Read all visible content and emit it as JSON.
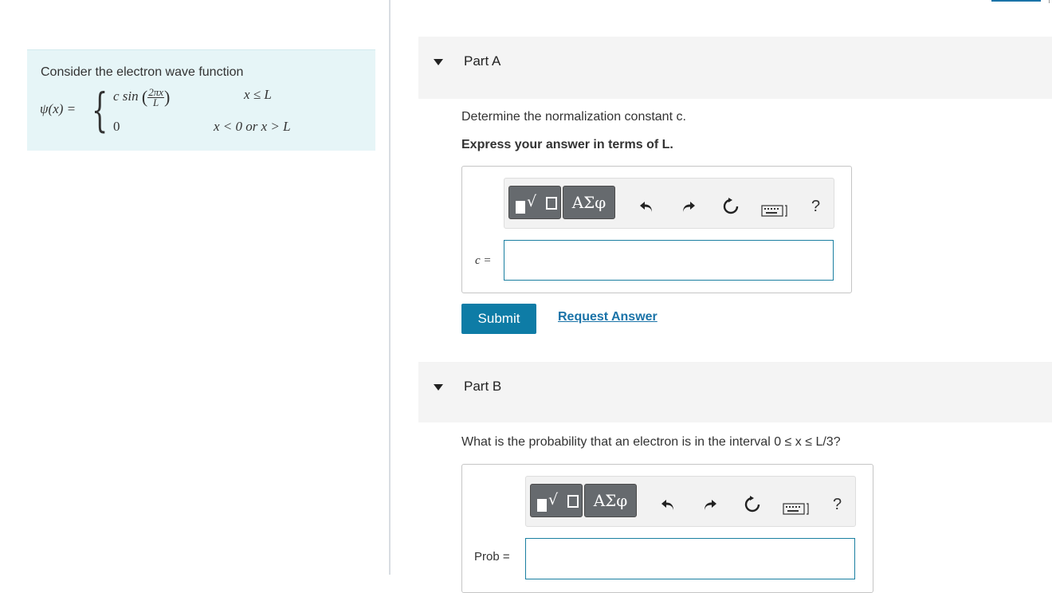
{
  "problem": {
    "intro": "Consider the electron wave function",
    "lhs": "ψ(x) =",
    "case1": {
      "prefix": "c sin",
      "frac_num": "2πx",
      "frac_den": "L",
      "condition": "x ≤ L"
    },
    "case2": {
      "value": "0",
      "condition": "x < 0 or x > L"
    }
  },
  "partA": {
    "title": "Part A",
    "question": "Determine the normalization constant c.",
    "instruction": "Express your answer in terms of L.",
    "label": "c =",
    "input_value": ""
  },
  "partB": {
    "title": "Part B",
    "question": "What is the probability that an electron is in the interval 0 ≤ x ≤ L/3?",
    "label": "Prob =",
    "input_value": ""
  },
  "toolbar": {
    "symbols_label": "ΑΣφ",
    "help_label": "?",
    "icons": [
      "templates-icon",
      "undo-icon",
      "redo-icon",
      "reset-icon",
      "keyboard-icon",
      "help-icon"
    ]
  },
  "actions": {
    "submit_label": "Submit",
    "request_answer_label": "Request Answer"
  },
  "colors": {
    "accent": "#0e7ca6",
    "link": "#1a73a8",
    "problem_bg": "#e6f5f7",
    "header_bg": "#f4f4f4"
  }
}
